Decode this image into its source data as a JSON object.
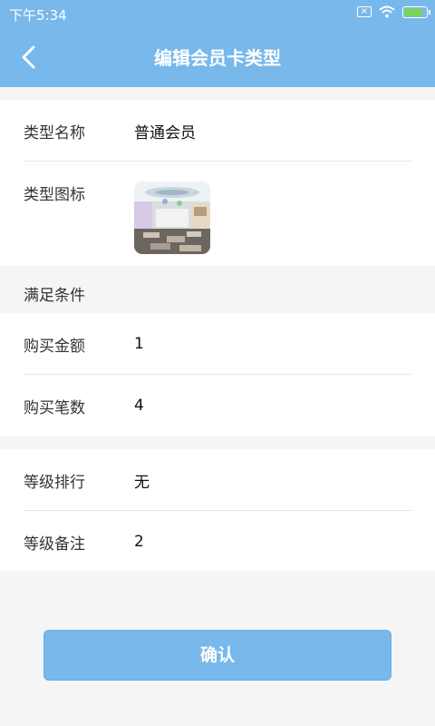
{
  "status_bar": {
    "time": "下午5:34",
    "icons": [
      "sim-off-icon",
      "wifi-icon",
      "battery-charging-icon"
    ]
  },
  "nav": {
    "title": "编辑会员卡类型",
    "back_icon": "chevron-left-icon"
  },
  "basic": {
    "type_name_label": "类型名称",
    "type_name_value": "普通会员",
    "type_icon_label": "类型图标"
  },
  "conditions": {
    "title": "满足条件",
    "amount_label": "购买金额",
    "amount_value": "1",
    "count_label": "购买笔数",
    "count_value": "4"
  },
  "level": {
    "rank_label": "等级排行",
    "rank_value": "无",
    "note_label": "等级备注",
    "note_value": "2"
  },
  "actions": {
    "confirm_label": "确认"
  },
  "colors": {
    "primary": "#78b8ea",
    "background": "#f5f5f5"
  }
}
